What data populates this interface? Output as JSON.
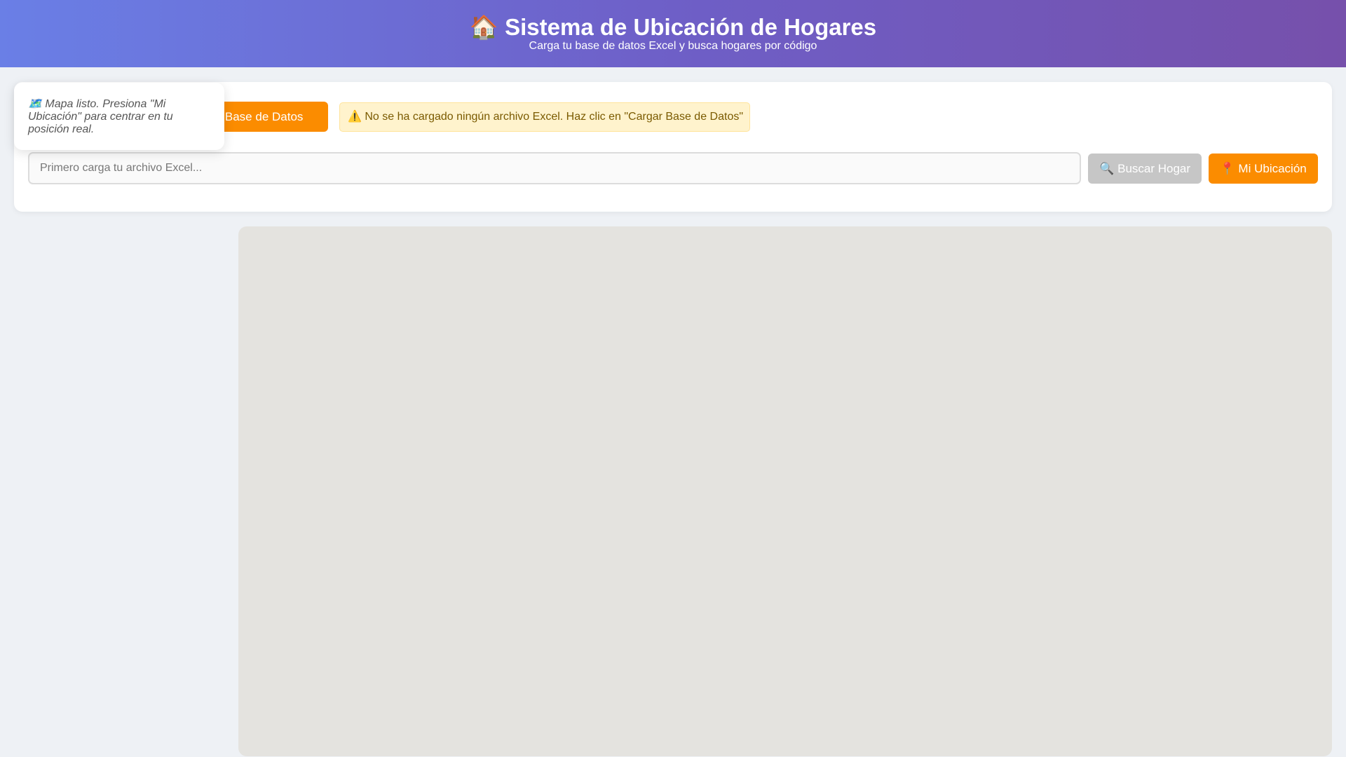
{
  "header": {
    "icon": "house-icon",
    "icon_glyph": "🏠",
    "title": "Sistema de Ubicación de Hogares",
    "subtitle": "Carga tu base de datos Excel y busca hogares por código"
  },
  "controls": {
    "load_button_label": "Cargar Base de Datos",
    "load_button_visible_label": "gar Base de Datos",
    "warning_icon": "warning-icon",
    "warning_glyph": "⚠️",
    "warning_text": "No se ha cargado ningún archivo Excel. Haz clic en \"Cargar Base de Datos\"",
    "search_placeholder": "Primero carga tu archivo Excel...",
    "search_value": "",
    "search_button_icon": "magnifier-icon",
    "search_button_glyph": "🔍",
    "search_button_label": "Buscar Hogar",
    "location_button_icon": "pin-icon",
    "location_button_glyph": "📍",
    "location_button_label": "Mi Ubicación"
  },
  "toast": {
    "icon": "map-icon",
    "icon_glyph": "🗺️",
    "message": "Mapa listo. Presiona \"Mi Ubicación\" para centrar en tu posición real."
  },
  "colors": {
    "header_gradient_start": "#6a7fe6",
    "header_gradient_end": "#7650ab",
    "accent_orange": "#fb8c00",
    "disabled_gray": "#c6c6c6",
    "warning_bg": "#fff3cd",
    "warning_text": "#7a5a00",
    "map_bg": "#e4e3df",
    "page_bg": "#eef1f5"
  }
}
